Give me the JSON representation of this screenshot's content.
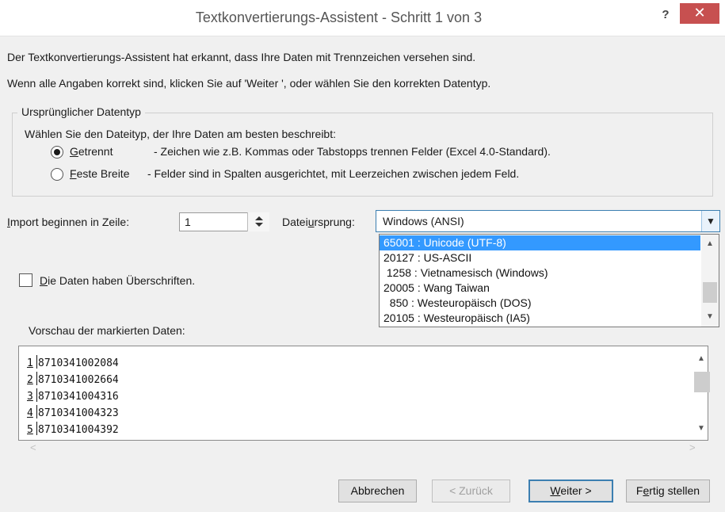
{
  "window": {
    "title": "Textkonvertierungs-Assistent - Schritt 1 von 3",
    "help_glyph": "?",
    "close_glyph": "✕"
  },
  "intro": {
    "line1": "Der Textkonvertierungs-Assistent hat erkannt, dass Ihre Daten mit Trennzeichen versehen sind.",
    "line2": "Wenn alle Angaben korrekt sind, klicken Sie auf 'Weiter ', oder wählen Sie den korrekten Datentyp."
  },
  "original_type": {
    "group_title": "Ursprünglicher Datentyp",
    "prompt": "Wählen Sie den Dateityp, der Ihre Daten am besten beschreibt:",
    "options": [
      {
        "key": "G",
        "rest": "etrennt",
        "description": "- Zeichen wie z.B. Kommas oder Tabstopps trennen Felder (Excel 4.0-Standard).",
        "checked": true
      },
      {
        "key": "F",
        "rest": "este Breite",
        "description": "- Felder sind in Spalten ausgerichtet, mit Leerzeichen zwischen jedem Feld.",
        "checked": false
      }
    ]
  },
  "import": {
    "start_key": "I",
    "start_rest": "mport beginnen in Zeile:",
    "start_value": "1",
    "origin_pre": "Datei",
    "origin_key": "u",
    "origin_post": "rsprung:",
    "origin_value": "Windows (ANSI)",
    "origin_options": [
      "65001 : Unicode (UTF-8)",
      "20127 : US-ASCII",
      " 1258 : Vietnamesisch (Windows)",
      "20005 : Wang Taiwan",
      "  850 : Westeuropäisch (DOS)",
      "20105 : Westeuropäisch (IA5)"
    ],
    "origin_selected_index": 0
  },
  "headers_checkbox": {
    "key": "D",
    "rest": "ie Daten haben Überschriften.",
    "checked": false
  },
  "preview": {
    "label": "Vorschau der markierten Daten:",
    "rows": [
      {
        "num": "1",
        "value": "8710341002084"
      },
      {
        "num": "2",
        "value": "8710341002664"
      },
      {
        "num": "3",
        "value": "8710341004316"
      },
      {
        "num": "4",
        "value": "8710341004323"
      },
      {
        "num": "5",
        "value": "8710341004392"
      }
    ]
  },
  "buttons": {
    "cancel": "Abbrechen",
    "back": "< Zurück",
    "next_key": "W",
    "next_rest": "eiter >",
    "finish_pre": "F",
    "finish_key": "e",
    "finish_rest": "rtig stellen"
  },
  "colors": {
    "close_button": "#c75050",
    "selection": "#3399ff",
    "focus_border": "#3c7fb1"
  }
}
